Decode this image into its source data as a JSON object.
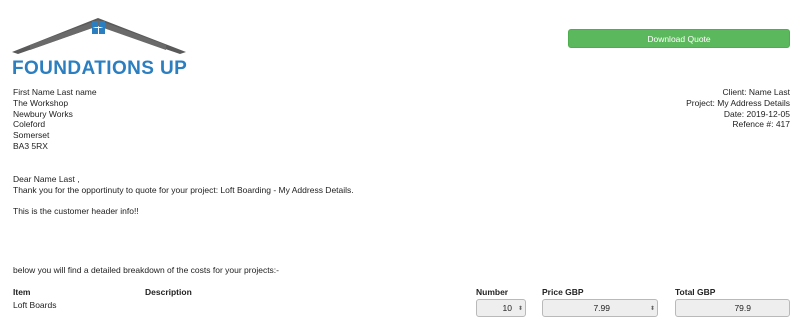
{
  "brand": {
    "name": "FOUNDATIONS UP",
    "color": "#2b7fc1",
    "roof_color": "#5a5a5a"
  },
  "actions": {
    "download_label": "Download Quote",
    "download_color": "#5cb85c"
  },
  "sender_address": [
    "First Name Last name",
    "The Workshop",
    "Newbury Works",
    "Coleford",
    "Somerset",
    "BA3 5RX"
  ],
  "client_info": [
    "Client: Name Last",
    "Project: My Address Details",
    "Date: 2019-12-05",
    "Refence #: 417"
  ],
  "letter": {
    "greeting": "Dear Name Last ,",
    "intro": "Thank you for the opportinuty to quote for your project: Loft Boarding - My Address Details.",
    "header_info": "This is the customer header info!!"
  },
  "breakdown_intro": "below you will find a detailed breakdown of the costs for your projects:-",
  "table": {
    "headers": {
      "item": "Item",
      "description": "Description",
      "number": "Number",
      "price": "Price GBP",
      "total": "Total GBP"
    },
    "rows": [
      {
        "item": "Loft Boards",
        "description": "",
        "number": "10",
        "price": "7.99",
        "total": "79.9"
      }
    ]
  }
}
